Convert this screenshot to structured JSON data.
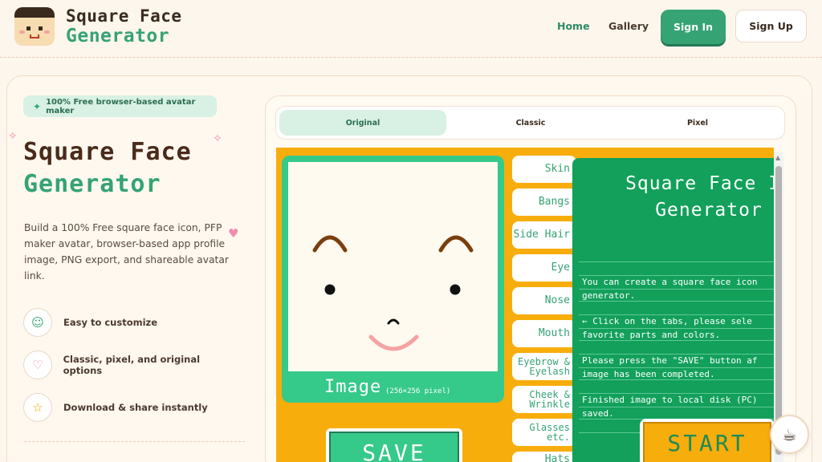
{
  "header": {
    "brand_line1": "Square Face",
    "brand_line2": "Generator",
    "nav": {
      "home": "Home",
      "gallery": "Gallery"
    },
    "sign_in": "Sign In",
    "sign_up": "Sign Up"
  },
  "hero": {
    "badge": "100% Free browser-based avatar maker",
    "title_line1": "Square Face",
    "title_line2": "Generator",
    "description": "Build a 100% Free square face icon, PFP maker avatar, browser-based app profile image, PNG export, and shareable avatar link.",
    "features": [
      {
        "label": "Easy to customize",
        "icon": "smile-icon"
      },
      {
        "label": "Classic, pixel, and original options",
        "icon": "heart-icon"
      },
      {
        "label": "Download & share instantly",
        "icon": "star-icon"
      }
    ]
  },
  "app": {
    "tabs": [
      "Original",
      "Classic",
      "Pixel"
    ],
    "active_tab": "Original",
    "image_label": "Image",
    "image_size": "(256×256 pixel)",
    "save_label": "SAVE",
    "parts": [
      "Skin",
      "Bangs",
      "Side Hair",
      "Eye",
      "Nose",
      "Mouth",
      "Eyebrow & Eyelash",
      "Cheek & Wrinkle",
      "Glasses etc.",
      "Hats"
    ],
    "overlay": {
      "title_line1": "Square Face Ic",
      "title_line2": "Generator",
      "lines": [
        "You can create a square face icon",
        "generator.",
        "← Click on the tabs, please sele",
        "favorite parts and colors.",
        "Please press the \"SAVE\" button af",
        "image has been completed.",
        "Finished image to local disk (PC)",
        "saved."
      ],
      "start_label": "START"
    }
  },
  "colors": {
    "accent": "#35a374",
    "stage": "#f7ad0c",
    "overlay": "#12a05b"
  }
}
